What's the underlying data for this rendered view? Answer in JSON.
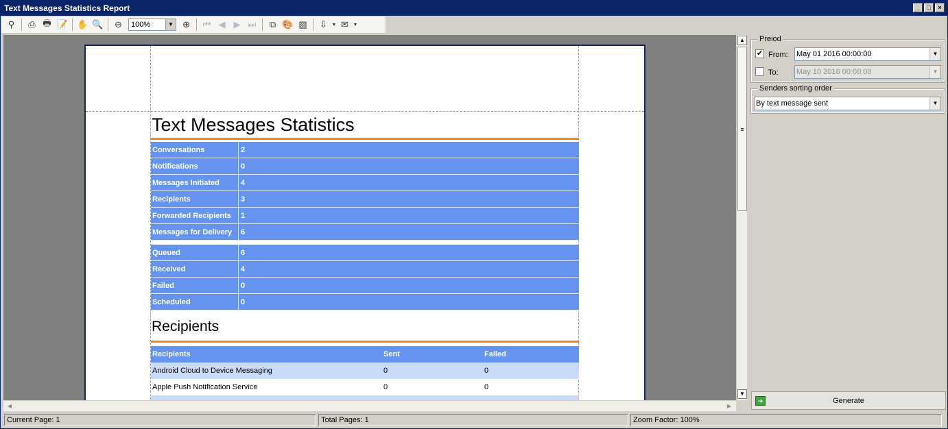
{
  "window": {
    "title": "Text Messages Statistics Report"
  },
  "toolbar": {
    "zoom_value": "100%"
  },
  "report": {
    "title": "Text Messages Statistics",
    "stats_group1": [
      {
        "label": "Conversations",
        "value": "2"
      },
      {
        "label": "Notifications",
        "value": "0"
      },
      {
        "label": "Messages Initiated",
        "value": "4"
      },
      {
        "label": "Recipients",
        "value": "3"
      },
      {
        "label": "Forwarded Recipients",
        "value": "1"
      },
      {
        "label": "Messages for Delivery",
        "value": "6"
      }
    ],
    "stats_group2": [
      {
        "label": "Queued",
        "value": "6"
      },
      {
        "label": "Received",
        "value": "4"
      },
      {
        "label": "Failed",
        "value": "0"
      },
      {
        "label": "Scheduled",
        "value": "0"
      }
    ],
    "recipients_heading": "Recipients",
    "recipients_table": {
      "headers": [
        "Recipients",
        "Sent",
        "Failed"
      ],
      "rows": [
        [
          "Android Cloud to Device Messaging",
          "0",
          "0"
        ],
        [
          "Apple Push Notification Service",
          "0",
          "0"
        ]
      ]
    }
  },
  "panel": {
    "period_label": "Preiod",
    "from_label": "From:",
    "from_checked": true,
    "from_value": "May 01 2016 00:00:00",
    "to_label": "To:",
    "to_checked": false,
    "to_value": "May 10 2016 00:00:00",
    "sorting_label": "Senders sorting order",
    "sorting_value": "By text message sent",
    "generate_label": "Generate"
  },
  "status": {
    "current_page": "Current Page: 1",
    "total_pages": "Total Pages: 1",
    "zoom_factor": "Zoom Factor: 100%"
  }
}
